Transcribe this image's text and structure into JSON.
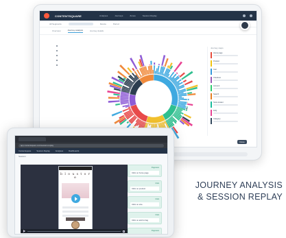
{
  "back_app": {
    "brand": "CONTENTSQUARE",
    "top_menu": [
      "Analyses",
      "Journeys",
      "Zones",
      "Session Replay"
    ],
    "subbar": [
      "All Segments",
      "Device",
      "Period"
    ],
    "tabs": [
      "Overview",
      "Journey analysis",
      "Journey details"
    ],
    "active_tab": "Journey analysis",
    "panel_title": "Journey steps",
    "panel_items": [
      {
        "label": "Home page",
        "color": "#e74c3c"
      },
      {
        "label": "Product",
        "color": "#f1c40f"
      },
      {
        "label": "Cart",
        "color": "#3498db"
      },
      {
        "label": "Checkout",
        "color": "#9b59b6"
      },
      {
        "label": "Account",
        "color": "#2ecc71"
      },
      {
        "label": "Search",
        "color": "#e67e22"
      },
      {
        "label": "Store locator",
        "color": "#1abc9c"
      },
      {
        "label": "FAQ",
        "color": "#e84393"
      },
      {
        "label": "Category",
        "color": "#34495e"
      }
    ],
    "button": "Done"
  },
  "front_app": {
    "url": "app.contentsquare.com/session-replay",
    "nav": [
      "Contentsquare",
      "Session Replay",
      "Analyses",
      "Dashboards"
    ],
    "info": "Session",
    "phone_brand": "b l o u s t o r e",
    "events": [
      {
        "tag": "Pageview",
        "text": "Click on home page"
      },
      {
        "tag": "Click",
        "text": "Click on product"
      },
      {
        "tag": "Click",
        "text": "Click on size"
      },
      {
        "tag": "Click",
        "text": "Click on add to bag"
      },
      {
        "tag": "Pageview",
        "text": "Click on cart"
      }
    ]
  },
  "caption": {
    "line1": "JOURNEY ANALYSIS",
    "line2": "& SESSION REPLAY"
  },
  "colors": {
    "nav_dark": "#233347",
    "accent_blue": "#3fa9e0",
    "caption": "#2e3e57",
    "event_bg": "#dff2ec"
  }
}
